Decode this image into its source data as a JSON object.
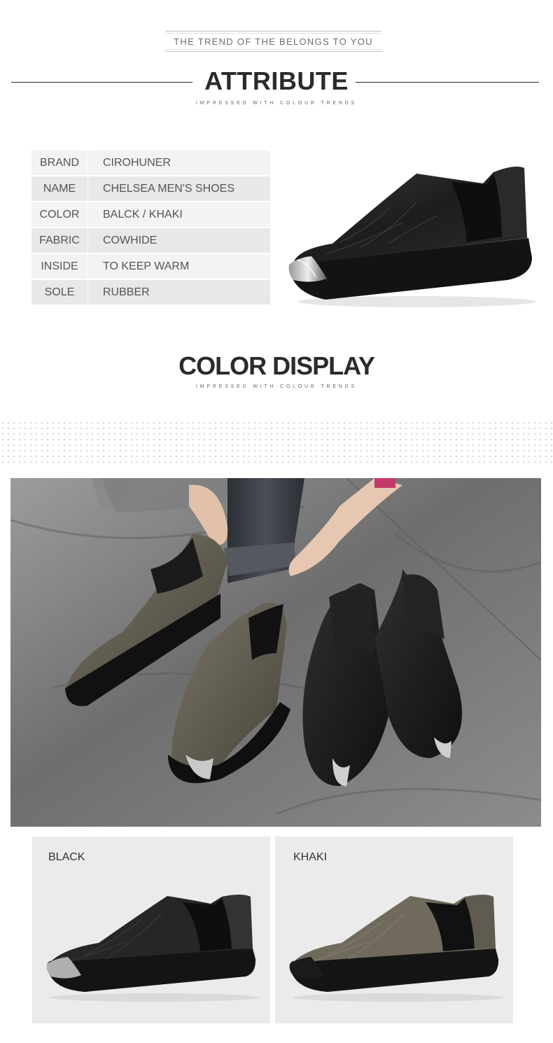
{
  "header": {
    "trend_text": "THE TREND OF THE BELONGS TO YOU",
    "title": "ATTRIBUTE",
    "subtitle": "IMPRESSED WITH COLOUR TRENDS"
  },
  "attributes": [
    {
      "key": "BRAND",
      "value": "CIROHUNER"
    },
    {
      "key": "NAME",
      "value": "CHELSEA MEN'S SHOES"
    },
    {
      "key": "COLOR",
      "value": "BALCK / KHAKI"
    },
    {
      "key": "FABRIC",
      "value": "COWHIDE"
    },
    {
      "key": "INSIDE",
      "value": "TO KEEP WARM"
    },
    {
      "key": "SOLE",
      "value": "RUBBER"
    }
  ],
  "color_display": {
    "title": "COLOR DISPLAY",
    "subtitle": "IMPRESSED WITH COLOUR TRENDS"
  },
  "swatches": [
    {
      "label": "BLACK",
      "color": "#1e1e1e"
    },
    {
      "label": "KHAKI",
      "color": "#6f6a5c"
    }
  ],
  "colors": {
    "black_leather": "#1f1f1f",
    "khaki_leather": "#6f6a5c",
    "sole": "#141414",
    "floor": "#7d7d7d",
    "jeans": "#3a3d43"
  }
}
